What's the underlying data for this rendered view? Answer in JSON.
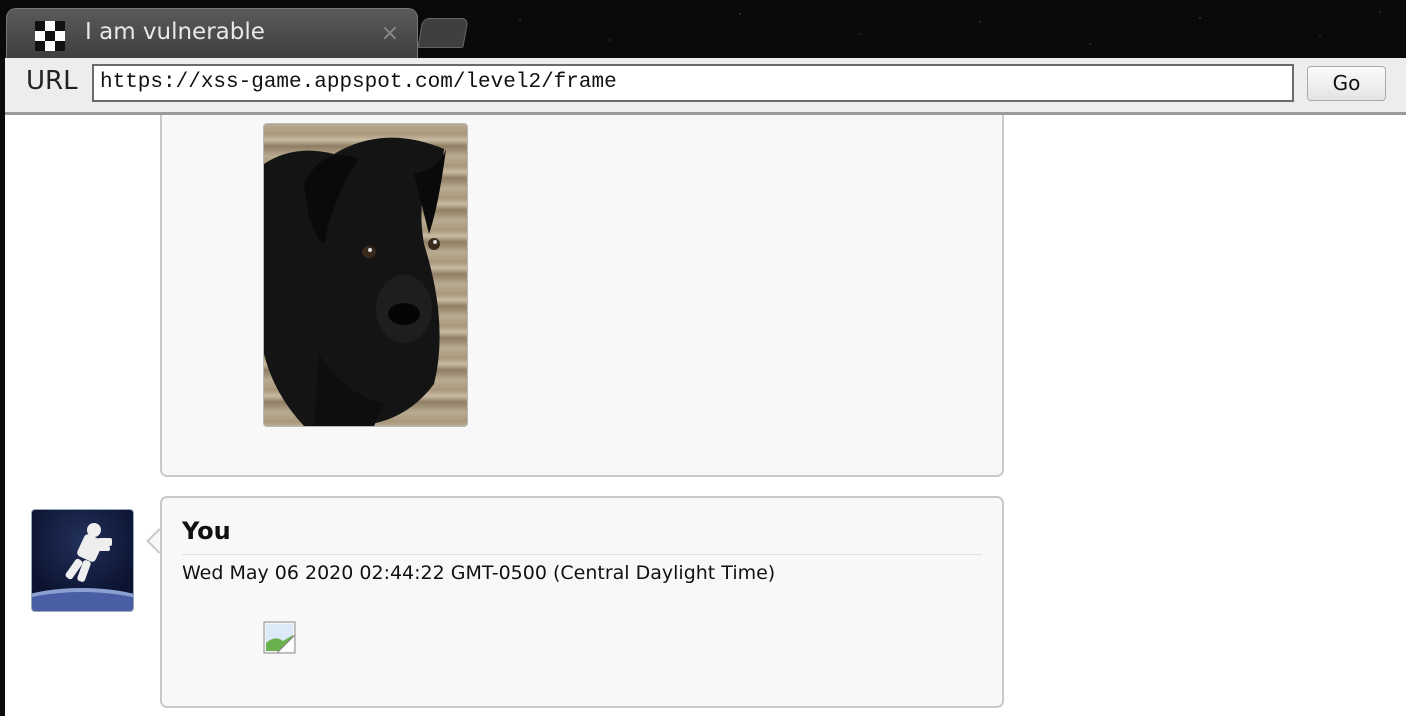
{
  "tab": {
    "title": "I am vulnerable",
    "close": "×"
  },
  "url_bar": {
    "label": "URL",
    "value": "https://xss-game.appspot.com/level2/frame",
    "go_label": "Go"
  },
  "posts": [
    {
      "image": "dog-photo"
    },
    {
      "author": "You",
      "date": "Wed May 06 2020 02:44:22 GMT-0500 (Central Daylight Time)",
      "image": "broken-image-icon"
    }
  ]
}
